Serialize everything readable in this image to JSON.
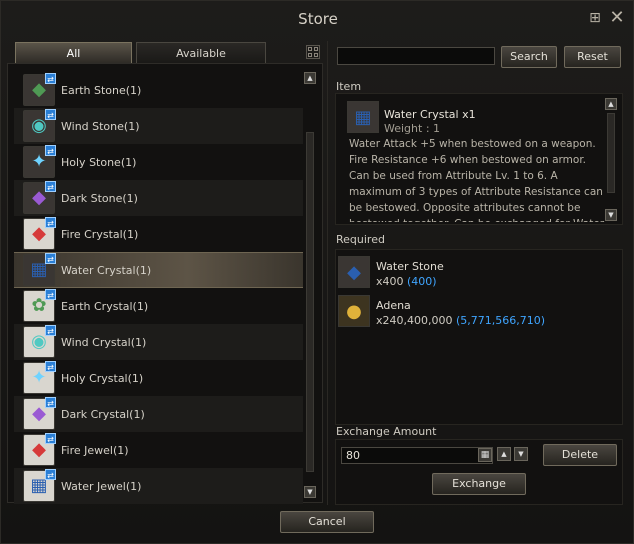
{
  "window": {
    "title": "Store"
  },
  "tabs": [
    {
      "label": "All"
    },
    {
      "label": "Available"
    }
  ],
  "items": [
    {
      "label": "Earth Stone(1)",
      "glyph": "◆",
      "color": "#4f9a54",
      "bg": "#3a3633"
    },
    {
      "label": "Wind Stone(1)",
      "glyph": "◉",
      "color": "#4fc9c2",
      "bg": "#3a3633"
    },
    {
      "label": "Holy Stone(1)",
      "glyph": "✦",
      "color": "#6fd3ff",
      "bg": "#3a3633"
    },
    {
      "label": "Dark Stone(1)",
      "glyph": "◆",
      "color": "#9a5ad3",
      "bg": "#3a3633"
    },
    {
      "label": "Fire Crystal(1)",
      "glyph": "◆",
      "color": "#d63a3a",
      "bg": "#d9d6cf"
    },
    {
      "label": "Water Crystal(1)",
      "glyph": "▦",
      "color": "#2a5fb0",
      "bg": "#3a3633"
    },
    {
      "label": "Earth Crystal(1)",
      "glyph": "✿",
      "color": "#4f9a54",
      "bg": "#d9d6cf"
    },
    {
      "label": "Wind Crystal(1)",
      "glyph": "◉",
      "color": "#4fc9c2",
      "bg": "#d9d6cf"
    },
    {
      "label": "Holy Crystal(1)",
      "glyph": "✦",
      "color": "#6fd3ff",
      "bg": "#d9d6cf"
    },
    {
      "label": "Dark Crystal(1)",
      "glyph": "◆",
      "color": "#9a5ad3",
      "bg": "#d9d6cf"
    },
    {
      "label": "Fire Jewel(1)",
      "glyph": "◆",
      "color": "#d63a3a",
      "bg": "#d9d6cf"
    },
    {
      "label": "Water Jewel(1)",
      "glyph": "▦",
      "color": "#2a5fb0",
      "bg": "#d9d6cf"
    }
  ],
  "selected_index": 5,
  "search": {
    "value": "",
    "button": "Search",
    "reset": "Reset"
  },
  "detail": {
    "section_label": "Item",
    "name": "Water Crystal x1",
    "weight": "Weight : 1",
    "description": "Water Attack +5 when bestowed on a weapon. Fire Resistance +6 when bestowed on armor. Can be used from Attribute Lv. 1 to 6. A maximum of 3 types of Attribute Resistance can be bestowed. Opposite attributes cannot be bestowed together. Can be exchanged for Water Jewels through Yin in Aden."
  },
  "required": {
    "section_label": "Required",
    "items": [
      {
        "name": "Water Stone",
        "qty": "x400",
        "owned": "(400)"
      },
      {
        "name": "Adena",
        "qty": "x240,400,000",
        "owned": "(5,771,566,710)"
      }
    ]
  },
  "exchange": {
    "section_label": "Exchange Amount",
    "amount": "80",
    "delete_label": "Delete",
    "exchange_label": "Exchange"
  },
  "cancel_label": "Cancel",
  "colors": {
    "accent_blue": "#3fa5ff",
    "badge_blue": "#2a7fd6"
  }
}
